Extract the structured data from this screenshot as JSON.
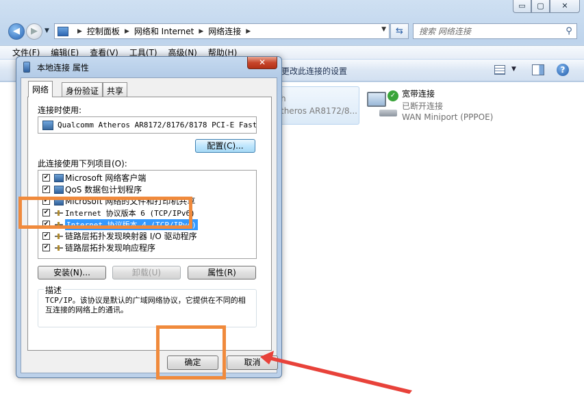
{
  "window_controls": {
    "minimize": "▭",
    "maximize": "▢",
    "close": "✕"
  },
  "address": {
    "crumbs": [
      "控制面板",
      "网络和 Internet",
      "网络连接"
    ],
    "search_placeholder": "搜索 网络连接"
  },
  "menubar": [
    "文件(F)",
    "编辑(E)",
    "查看(V)",
    "工具(T)",
    "高级(N)",
    "帮助(H)"
  ],
  "cmdbar": {
    "change_settings": "更改此连接的设置"
  },
  "adapters": {
    "local_partial_name": "theros AR8172/8...",
    "local_partial_sub": "h",
    "broadband": {
      "name": "宽带连接",
      "status": "已断开连接",
      "device": "WAN Miniport (PPPOE)"
    }
  },
  "dialog": {
    "title": "本地连接 属性",
    "close": "✕",
    "tabs": [
      "网络",
      "身份验证",
      "共享"
    ],
    "connect_using_label": "连接时使用:",
    "adapter_name": "Qualcomm Atheros AR8172/8176/8178 PCI-E Fast E",
    "configure_button": "配置(C)...",
    "items_label": "此连接使用下列项目(O):",
    "items": [
      {
        "label": "Microsoft 网络客户端",
        "checked": true,
        "selected": false,
        "icon": "network-client"
      },
      {
        "label": "QoS 数据包计划程序",
        "checked": true,
        "selected": false,
        "icon": "qos"
      },
      {
        "label": "Microsoft 网络的文件和打印机共享",
        "checked": true,
        "selected": false,
        "icon": "file-share"
      },
      {
        "label": "Internet 协议版本 6 (TCP/IPv6)",
        "checked": true,
        "selected": false,
        "icon": "protocol"
      },
      {
        "label": "Internet 协议版本 4 (TCP/IPv4)",
        "checked": true,
        "selected": true,
        "icon": "protocol"
      },
      {
        "label": "链路层拓扑发现映射器 I/O 驱动程序",
        "checked": true,
        "selected": false,
        "icon": "protocol"
      },
      {
        "label": "链路层拓扑发现响应程序",
        "checked": true,
        "selected": false,
        "icon": "protocol"
      }
    ],
    "install_button": "安装(N)...",
    "uninstall_button": "卸载(U)",
    "properties_button": "属性(R)",
    "description_label": "描述",
    "description_text": "TCP/IP。该协议是默认的广域网络协议，它提供在不同的相互连接的网络上的通讯。",
    "ok_button": "确定",
    "cancel_button": "取消"
  },
  "colors": {
    "annotation": "#f08a3c",
    "arrow": "#e8423a",
    "selection": "#3399ff"
  }
}
